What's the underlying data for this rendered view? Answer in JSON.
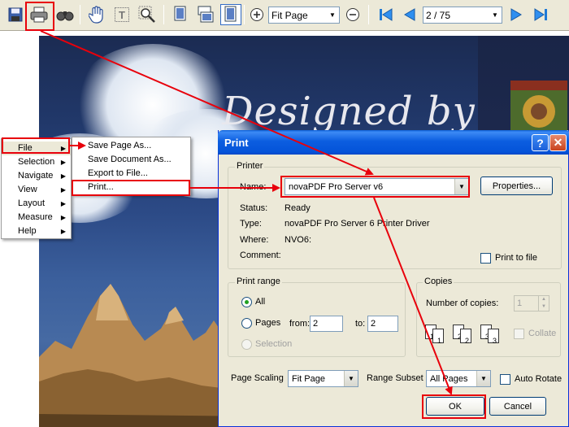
{
  "toolbar": {
    "zoom_value": "Fit Page",
    "page_value": "2 / 75",
    "icons": [
      "save-icon",
      "print-icon",
      "find-icon",
      "hand-icon",
      "text-select-icon",
      "zoom-icon",
      "single-page-icon",
      "continuous-icon",
      "facing-icon",
      "zoom-in-icon",
      "zoom-out-icon",
      "first-page-icon",
      "prev-page-icon",
      "next-page-icon",
      "last-page-icon"
    ]
  },
  "page": {
    "title": "Designed by"
  },
  "context_menu": {
    "items": [
      {
        "label": "File"
      },
      {
        "label": "Selection"
      },
      {
        "label": "Navigate"
      },
      {
        "label": "View"
      },
      {
        "label": "Layout"
      },
      {
        "label": "Measure"
      },
      {
        "label": "Help"
      }
    ],
    "submenu": [
      {
        "label": "Save Page As..."
      },
      {
        "label": "Save Document As..."
      },
      {
        "label": "Export to File..."
      },
      {
        "label": "Print..."
      }
    ]
  },
  "dialog": {
    "title": "Print",
    "printer": {
      "group_label": "Printer",
      "name_label": "Name:",
      "name_value": "novaPDF Pro Server v6",
      "properties_label": "Properties...",
      "status_label": "Status:",
      "status_value": "Ready",
      "type_label": "Type:",
      "type_value": "novaPDF Pro Server 6 Printer Driver",
      "where_label": "Where:",
      "where_value": "NVO6:",
      "comment_label": "Comment:",
      "print_to_file_label": "Print to file"
    },
    "range": {
      "group_label": "Print range",
      "all_label": "All",
      "pages_label": "Pages",
      "from_label": "from:",
      "from_value": "2",
      "to_label": "to:",
      "to_value": "2",
      "selection_label": "Selection"
    },
    "copies": {
      "group_label": "Copies",
      "number_label": "Number of copies:",
      "number_value": "1",
      "collate_label": "Collate",
      "sheet_labels": [
        "1",
        "1",
        "2",
        "2",
        "3",
        "3"
      ]
    },
    "scaling_label": "Page Scaling",
    "scaling_value": "Fit Page",
    "subset_label": "Range Subset",
    "subset_value": "All Pages",
    "auto_rotate_label": "Auto Rotate",
    "ok_label": "OK",
    "cancel_label": "Cancel"
  },
  "colors": {
    "annotation": "#e8000b",
    "title_bar": "#0453d9",
    "dialog_bg": "#ece9d8"
  }
}
